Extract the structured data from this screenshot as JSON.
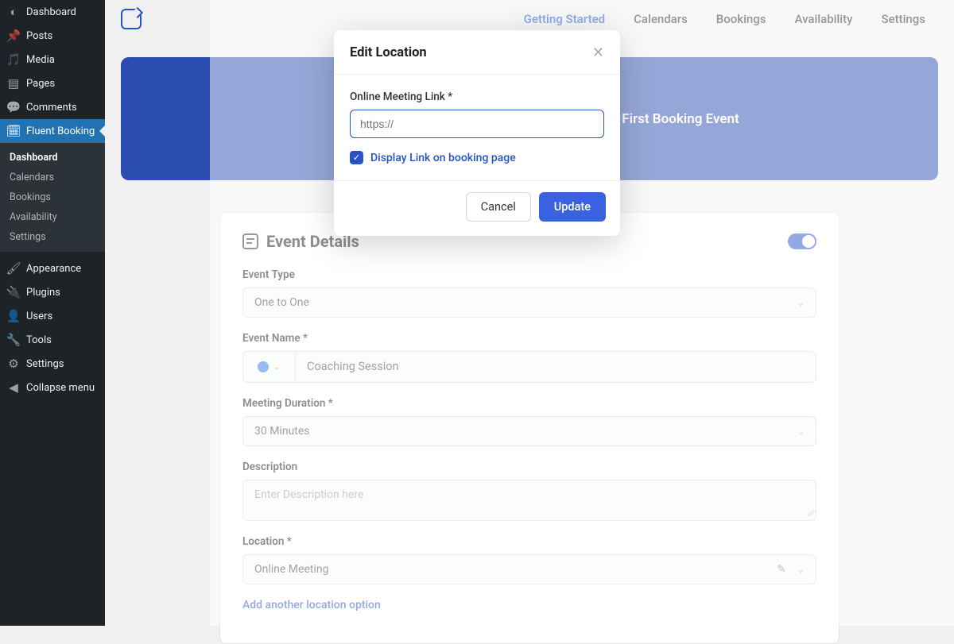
{
  "wp_sidebar": {
    "items": [
      {
        "label": "Dashboard",
        "icon": "gauge-icon"
      },
      {
        "label": "Posts",
        "icon": "pin-icon"
      },
      {
        "label": "Media",
        "icon": "media-icon"
      },
      {
        "label": "Pages",
        "icon": "pages-icon"
      },
      {
        "label": "Comments",
        "icon": "comment-icon"
      },
      {
        "label": "Fluent Booking",
        "icon": "calendar-icon",
        "active": true
      },
      {
        "label": "Appearance",
        "icon": "brush-icon"
      },
      {
        "label": "Plugins",
        "icon": "plug-icon"
      },
      {
        "label": "Users",
        "icon": "users-icon"
      },
      {
        "label": "Tools",
        "icon": "tools-icon"
      },
      {
        "label": "Settings",
        "icon": "sliders-icon"
      },
      {
        "label": "Collapse menu",
        "icon": "collapse-icon"
      }
    ],
    "sub": {
      "items": [
        {
          "label": "Dashboard",
          "current": true
        },
        {
          "label": "Calendars"
        },
        {
          "label": "Bookings"
        },
        {
          "label": "Availability"
        },
        {
          "label": "Settings"
        }
      ]
    }
  },
  "topnav": {
    "items": [
      {
        "label": "Getting Started",
        "active": true
      },
      {
        "label": "Calendars"
      },
      {
        "label": "Bookings"
      },
      {
        "label": "Availability"
      },
      {
        "label": "Settings"
      }
    ]
  },
  "banner": {
    "text_right": "First Booking Event"
  },
  "card": {
    "title": "Event Details",
    "event_type": {
      "label": "Event Type",
      "value": "One to One"
    },
    "event_name": {
      "label": "Event Name *",
      "value": "Coaching Session"
    },
    "duration": {
      "label": "Meeting Duration *",
      "value": "30 Minutes"
    },
    "description": {
      "label": "Description",
      "placeholder": "Enter Description here"
    },
    "location": {
      "label": "Location *",
      "value": "Online Meeting"
    },
    "add_location": "Add another location option"
  },
  "modal": {
    "title": "Edit Location",
    "link_label": "Online Meeting Link *",
    "link_placeholder": "https://",
    "checkbox_label": "Display Link on booking page",
    "cancel": "Cancel",
    "update": "Update"
  }
}
